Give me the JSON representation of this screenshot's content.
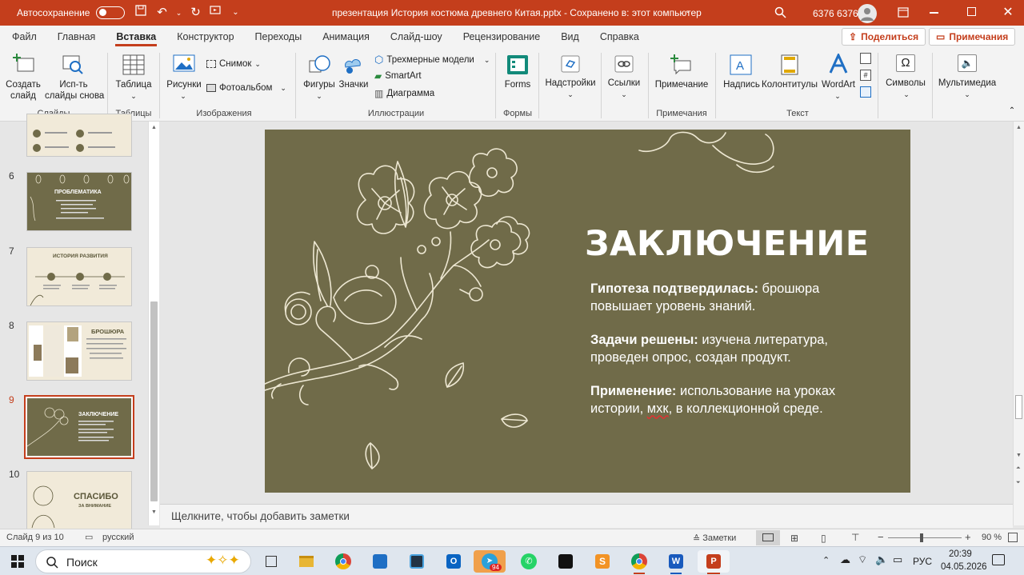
{
  "titlebar": {
    "autosave_label": "Автосохранение",
    "autosave_state": "off",
    "document_title": "презентация История костюма древнего Китая.pptx  -  Сохранено в: этот компьютер",
    "user_name": "6376 6376"
  },
  "tabs": [
    "Файл",
    "Главная",
    "Вставка",
    "Конструктор",
    "Переходы",
    "Анимация",
    "Слайд-шоу",
    "Рецензирование",
    "Вид",
    "Справка"
  ],
  "active_tab": "Вставка",
  "share_label": "Поделиться",
  "comments_label": "Примечания",
  "ribbon": {
    "new_slide": "Создать\nслайд",
    "reuse_slides": "Исп-ть\nслайды снова",
    "group_slides": "Слайды",
    "table": "Таблица",
    "group_tables": "Таблицы",
    "pictures": "Рисунки",
    "screenshot": "Снимок",
    "photo_album": "Фотоальбом",
    "group_images": "Изображения",
    "shapes": "Фигуры",
    "icons": "Значки",
    "models3d": "Трехмерные модели",
    "smartart": "SmartArt",
    "chart": "Диаграмма",
    "group_illustrations": "Иллюстрации",
    "forms": "Forms",
    "group_forms": "Формы",
    "addins": "Надстройки",
    "links": "Ссылки",
    "comment": "Примечание",
    "group_comments": "Примечания",
    "textbox": "Надпись",
    "header_footer": "Колонтитулы",
    "wordart": "WordArt",
    "group_text": "Текст",
    "symbols": "Символы",
    "media": "Мультимедиа"
  },
  "thumbnails": [
    {
      "num": "6",
      "title": "ПРОБЛЕМАТИКА",
      "style": "dark"
    },
    {
      "num": "7",
      "title": "ИСТОРИЯ РАЗВИТИЯ",
      "style": "light"
    },
    {
      "num": "8",
      "title": "БРОШЮРА",
      "style": "light"
    },
    {
      "num": "9",
      "title": "ЗАКЛЮЧЕНИЕ",
      "style": "dark"
    },
    {
      "num": "10",
      "title": "СПАСИБО",
      "subtitle": "ЗА ВНИМАНИЕ",
      "style": "light"
    }
  ],
  "selected_slide": "9",
  "slide": {
    "title": "ЗАКЛЮЧЕНИЕ",
    "p1_bold": "Гипотеза подтвердилась:",
    "p1_rest": " брошюра повышает уровень знаний.",
    "p2_bold": "Задачи решены:",
    "p2_rest": " изучена литература, проведен опрос, создан продукт.",
    "p3_bold": "Применение:",
    "p3_mid": " использование на уроках истории, ",
    "p3_underlined": "мхк",
    "p3_end": ", в коллекционной среде."
  },
  "notes_placeholder": "Щелкните, чтобы добавить заметки",
  "status": {
    "slide_info": "Слайд 9 из 10",
    "language": "русский",
    "notes_label": "Заметки",
    "zoom": "90 %"
  },
  "taskbar": {
    "search_label": "Поиск",
    "lang": "РУС",
    "time": "20:39",
    "date": "04.05.2026",
    "telegram_badge": "94"
  },
  "colors": {
    "accent": "#c43e1c",
    "slide_bg": "#706b49",
    "slide_text": "#ffffff"
  }
}
